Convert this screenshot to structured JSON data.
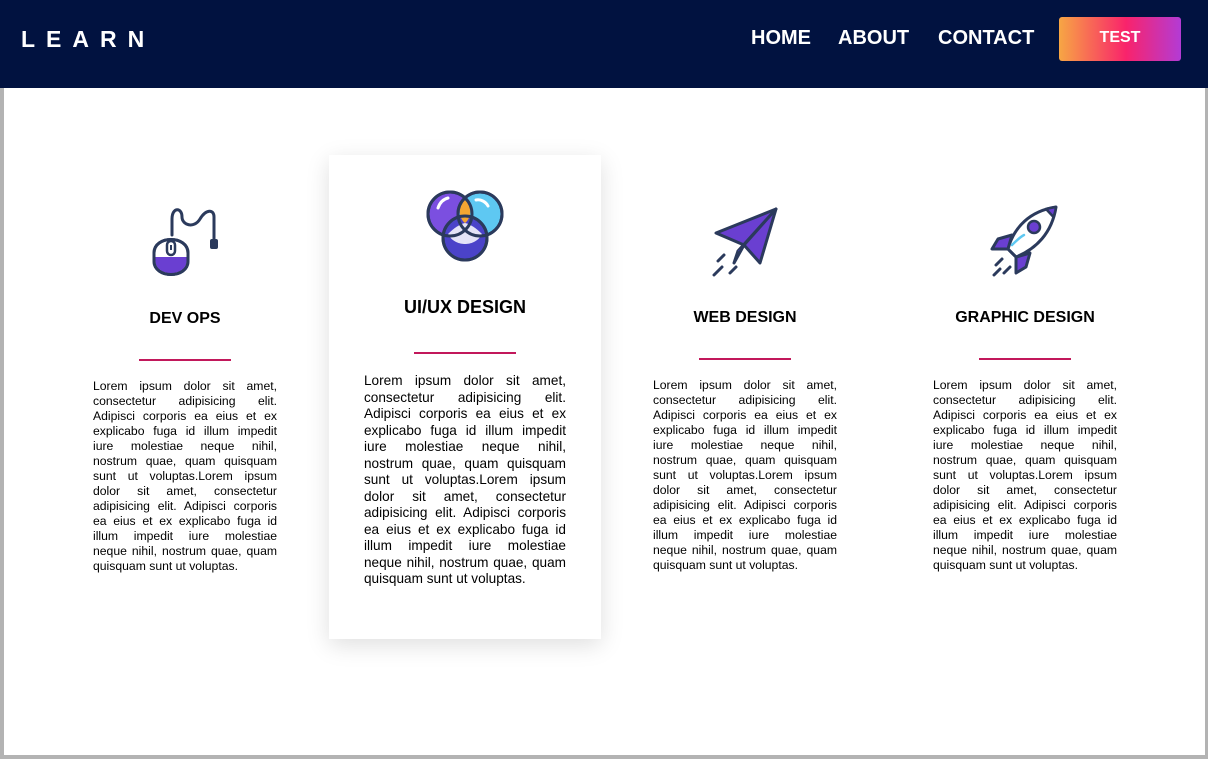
{
  "navbar": {
    "logo": "LEARN",
    "links": [
      "HOME",
      "ABOUT",
      "CONTACT"
    ],
    "cta_label": "TEST"
  },
  "colors": {
    "nav_bg": "#011240",
    "accent_line": "#c2185b",
    "icon_purple": "#6a3fd1",
    "icon_blue": "#5ec8f2",
    "icon_outline": "#2b3a5c"
  },
  "cards": [
    {
      "icon": "mouse-icon",
      "title": "DEV OPS",
      "text": "Lorem ipsum dolor sit amet, consectetur adipisicing elit. Adipisci corporis ea eius et ex explicabo fuga id illum impedit iure molestiae neque nihil, nostrum quae, quam quisquam sunt ut voluptas.Lorem ipsum dolor sit amet, consectetur adipisicing elit. Adipisci corporis ea eius et ex explicabo fuga id illum impedit iure molestiae neque nihil, nostrum quae, quam quisquam sunt ut voluptas."
    },
    {
      "icon": "venn-diagram-icon",
      "title": "UI/UX DESIGN",
      "text": "Lorem ipsum dolor sit amet, consectetur adipisicing elit. Adipisci corporis ea eius et ex explicabo fuga id illum impedit iure molestiae neque nihil, nostrum quae, quam quisquam sunt ut voluptas.Lorem ipsum dolor sit amet, consectetur adipisicing elit. Adipisci corporis ea eius et ex explicabo fuga id illum impedit iure molestiae neque nihil, nostrum quae, quam quisquam sunt ut voluptas."
    },
    {
      "icon": "paper-plane-icon",
      "title": "WEB DESIGN",
      "text": "Lorem ipsum dolor sit amet, consectetur adipisicing elit. Adipisci corporis ea eius et ex explicabo fuga id illum impedit iure molestiae neque nihil, nostrum quae, quam quisquam sunt ut voluptas.Lorem ipsum dolor sit amet, consectetur adipisicing elit. Adipisci corporis ea eius et ex explicabo fuga id illum impedit iure molestiae neque nihil, nostrum quae, quam quisquam sunt ut voluptas."
    },
    {
      "icon": "rocket-icon",
      "title": "GRAPHIC DESIGN",
      "text": "Lorem ipsum dolor sit amet, consectetur adipisicing elit. Adipisci corporis ea eius et ex explicabo fuga id illum impedit iure molestiae neque nihil, nostrum quae, quam quisquam sunt ut voluptas.Lorem ipsum dolor sit amet, consectetur adipisicing elit. Adipisci corporis ea eius et ex explicabo fuga id illum impedit iure molestiae neque nihil, nostrum quae, quam quisquam sunt ut voluptas."
    }
  ]
}
